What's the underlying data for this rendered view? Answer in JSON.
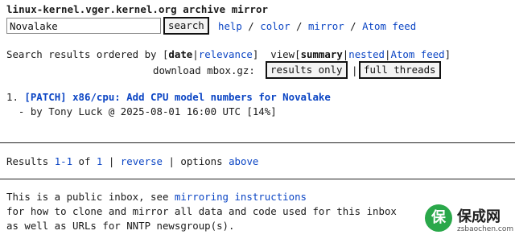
{
  "header": {
    "title": "linux-kernel.vger.kernel.org archive mirror"
  },
  "search": {
    "value": "Novalake",
    "button_label": "search"
  },
  "topnav": {
    "help": "help",
    "color": "color",
    "mirror": "mirror",
    "atom": "Atom feed",
    "sep": " / "
  },
  "ordering": {
    "prefix": "Search results ordered by [",
    "date": "date",
    "bar": "|",
    "relevance": "relevance",
    "suffix": "]",
    "view_prefix": "  view[",
    "summary": "summary",
    "nested": "nested",
    "atom": "Atom feed",
    "view_suffix": "]"
  },
  "download": {
    "label": "download mbox.gz:",
    "results_only": "results only",
    "bar": "|",
    "full_threads": "full threads"
  },
  "results": [
    {
      "index": "1.",
      "title": "[PATCH] x86/cpu: Add CPU model numbers for Novalake",
      "meta": "  - by Tony Luck @ 2025-08-01 16:00 UTC [14%]"
    }
  ],
  "pager": {
    "prefix": "Results ",
    "range": "1-1",
    "of": " of ",
    "total": "1",
    "sep": " | ",
    "reverse": "reverse",
    "options": " | options ",
    "above": "above"
  },
  "footer": {
    "line1_prefix": "This is a public inbox, see ",
    "line1_link": "mirroring instructions",
    "line2": "for how to clone and mirror all data and code used for this inbox",
    "line3": "as well as URLs for NNTP newsgroup(s)."
  },
  "watermark": {
    "logo_char": "保",
    "text": "保成网",
    "sub": "zsbaochen.com"
  }
}
